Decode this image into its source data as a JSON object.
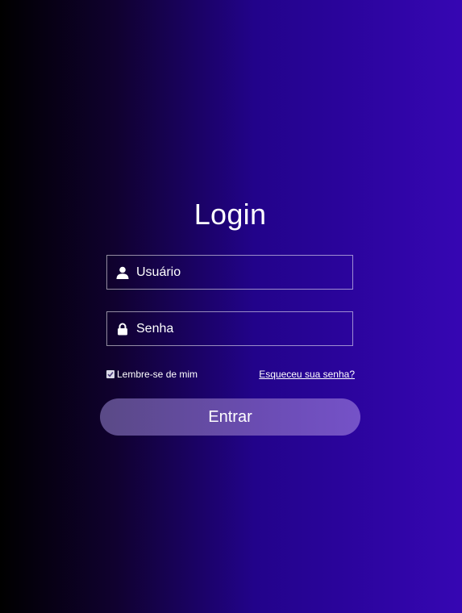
{
  "login": {
    "title": "Login",
    "username": {
      "placeholder": "Usuário",
      "value": "",
      "icon": "user-icon"
    },
    "password": {
      "placeholder": "Senha",
      "value": "",
      "icon": "lock-icon"
    },
    "remember_me": {
      "label": "Lembre-se de mim",
      "checked": true
    },
    "forgot_password_label": "Esqueceu sua senha?",
    "submit_label": "Entrar"
  },
  "colors": {
    "background_start": "#000000",
    "background_end": "#3606b3",
    "button_start": "#5a4a86",
    "button_end": "#7552c8",
    "text": "#ffffff"
  }
}
